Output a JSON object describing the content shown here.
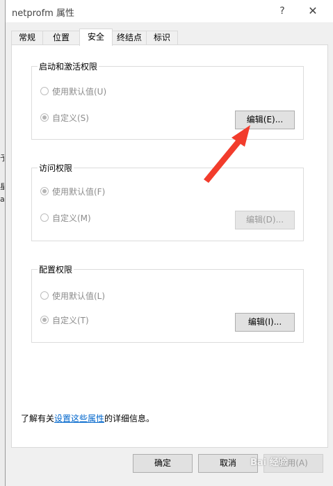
{
  "window": {
    "title": "netprofm 属性",
    "help": "?",
    "close": "✕"
  },
  "background_fragments": [
    "予",
    "星",
    "ar"
  ],
  "tabs": [
    {
      "label": "常规",
      "active": false
    },
    {
      "label": "位置",
      "active": false
    },
    {
      "label": "安全",
      "active": true
    },
    {
      "label": "终结点",
      "active": false
    },
    {
      "label": "标识",
      "active": false
    }
  ],
  "groups": {
    "launch": {
      "title": "启动和激活权限",
      "default_label": "使用默认值(U)",
      "custom_label": "自定义(S)",
      "selected": "custom",
      "edit_label": "编辑(E)...",
      "edit_enabled": true
    },
    "access": {
      "title": "访问权限",
      "default_label": "使用默认值(F)",
      "custom_label": "自定义(M)",
      "selected": "default",
      "edit_label": "编辑(D)...",
      "edit_enabled": false
    },
    "config": {
      "title": "配置权限",
      "default_label": "使用默认值(L)",
      "custom_label": "自定义(T)",
      "selected": "custom",
      "edit_label": "编辑(I)...",
      "edit_enabled": true
    }
  },
  "info": {
    "prefix": "了解有关",
    "link": "设置这些属性",
    "suffix": "的详细信息。"
  },
  "footer": {
    "ok": "确定",
    "cancel": "取消",
    "apply": "应用(A)"
  },
  "watermark": "Bai 经验",
  "colors": {
    "arrow": "#f23c2c",
    "link": "#0066cc"
  }
}
